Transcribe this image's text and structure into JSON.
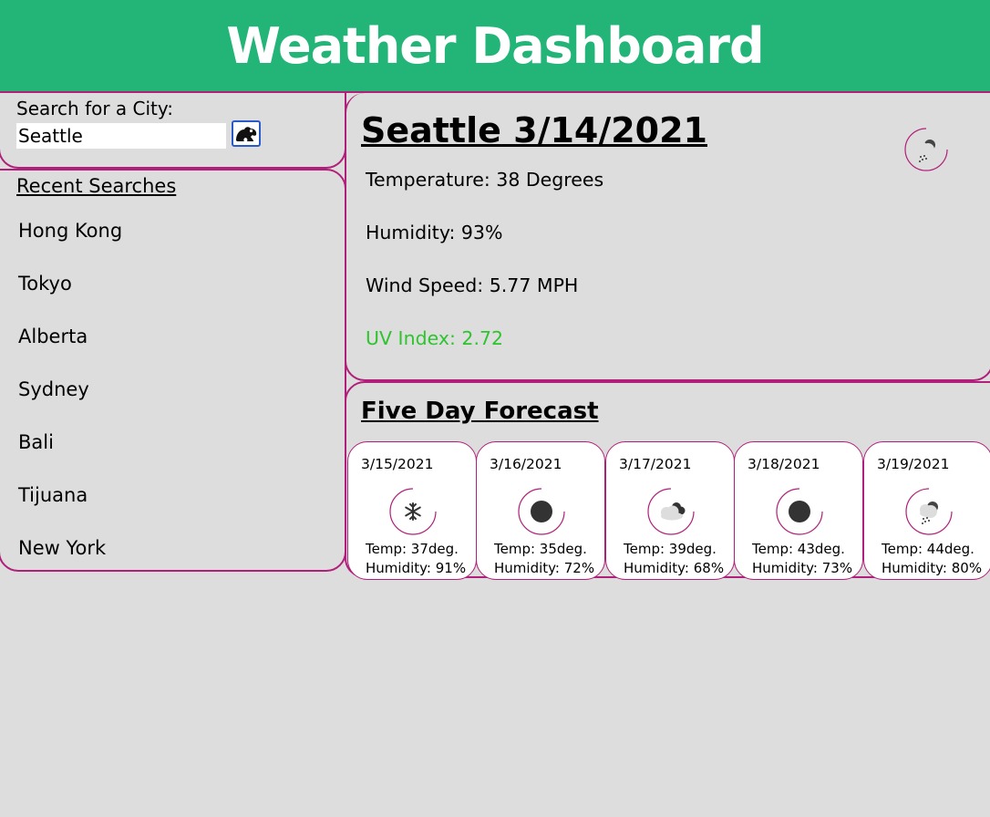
{
  "header": {
    "title": "Weather Dashboard"
  },
  "search": {
    "label": "Search for a City:",
    "value": "Seattle",
    "button_icon": "frog-icon"
  },
  "recent": {
    "title": "Recent Searches",
    "items": [
      "Hong Kong",
      "Tokyo",
      "Alberta",
      "Sydney",
      "Bali",
      "Tijuana",
      "New York"
    ]
  },
  "current": {
    "title": "Seattle 3/14/2021",
    "icon": "rain-cloud-icon",
    "temperature": "Temperature: 38 Degrees",
    "humidity": "Humidity: 93%",
    "wind": "Wind Speed: 5.77 MPH",
    "uv": "UV Index: 2.72",
    "uv_color": "#2ec42e"
  },
  "forecast": {
    "title": "Five Day Forecast",
    "days": [
      {
        "date": "3/15/2021",
        "icon": "snow-icon",
        "temp": "Temp: 37deg.",
        "humidity": "Humidity: 91%"
      },
      {
        "date": "3/16/2021",
        "icon": "clear-night-icon",
        "temp": "Temp: 35deg.",
        "humidity": "Humidity: 72%"
      },
      {
        "date": "3/17/2021",
        "icon": "cloudy-icon",
        "temp": "Temp: 39deg.",
        "humidity": "Humidity: 68%"
      },
      {
        "date": "3/18/2021",
        "icon": "clear-night-icon",
        "temp": "Temp: 43deg.",
        "humidity": "Humidity: 73%"
      },
      {
        "date": "3/19/2021",
        "icon": "rain-cloud-icon",
        "temp": "Temp: 44deg.",
        "humidity": "Humidity: 80%"
      }
    ]
  },
  "colors": {
    "header": "#23b478",
    "border": "#b0207a",
    "background": "#dddddd"
  }
}
